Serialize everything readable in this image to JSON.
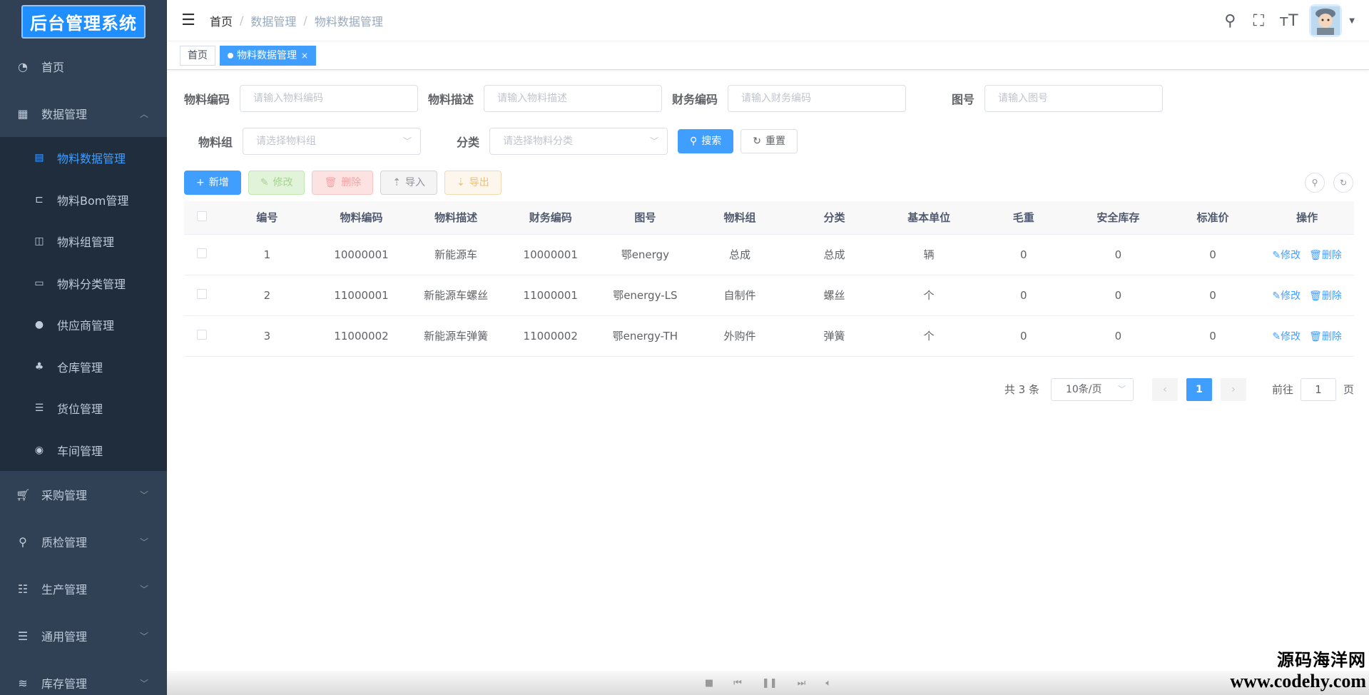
{
  "app": {
    "logo_text": "后台管理系统"
  },
  "sidebar": {
    "items": [
      {
        "label": "首页",
        "icon": "dashboard-icon"
      },
      {
        "label": "数据管理",
        "icon": "grid-icon",
        "expanded": true,
        "children": [
          {
            "label": "物料数据管理",
            "icon": "document-icon",
            "active": true
          },
          {
            "label": "物料Bom管理",
            "icon": "tree-icon"
          },
          {
            "label": "物料组管理",
            "icon": "columns-icon"
          },
          {
            "label": "物料分类管理",
            "icon": "rectangle-icon"
          },
          {
            "label": "供应商管理",
            "icon": "user-icon"
          },
          {
            "label": "仓库管理",
            "icon": "org-chart-icon"
          },
          {
            "label": "货位管理",
            "icon": "list-icon"
          },
          {
            "label": "车间管理",
            "icon": "radio-icon"
          }
        ]
      },
      {
        "label": "采购管理",
        "icon": "cart-icon"
      },
      {
        "label": "质检管理",
        "icon": "search-icon"
      },
      {
        "label": "生产管理",
        "icon": "sliders-icon"
      },
      {
        "label": "通用管理",
        "icon": "list-icon"
      },
      {
        "label": "库存管理",
        "icon": "stack-icon"
      }
    ]
  },
  "navbar": {
    "breadcrumb": [
      "首页",
      "数据管理",
      "物料数据管理"
    ]
  },
  "tags": [
    {
      "label": "首页",
      "active": false
    },
    {
      "label": "物料数据管理",
      "active": true
    }
  ],
  "filters": {
    "material_code": {
      "label": "物料编码",
      "placeholder": "请输入物料编码"
    },
    "material_desc": {
      "label": "物料描述",
      "placeholder": "请输入物料描述"
    },
    "finance_code": {
      "label": "财务编码",
      "placeholder": "请输入财务编码"
    },
    "drawing_no": {
      "label": "图号",
      "placeholder": "请输入图号"
    },
    "material_group": {
      "label": "物料组",
      "placeholder": "请选择物料组"
    },
    "category": {
      "label": "分类",
      "placeholder": "请选择物料分类"
    },
    "search_label": "搜索",
    "reset_label": "重置"
  },
  "toolbar": {
    "add_label": "新增",
    "edit_label": "修改",
    "delete_label": "删除",
    "import_label": "导入",
    "export_label": "导出"
  },
  "table": {
    "headers": [
      "编号",
      "物料编码",
      "物料描述",
      "财务编码",
      "图号",
      "物料组",
      "分类",
      "基本单位",
      "毛重",
      "安全库存",
      "标准价",
      "操作"
    ],
    "edit_action": "修改",
    "delete_action": "删除",
    "rows": [
      [
        "1",
        "10000001",
        "新能源车",
        "10000001",
        "鄂energy",
        "总成",
        "总成",
        "辆",
        "0",
        "0",
        "0"
      ],
      [
        "2",
        "11000001",
        "新能源车螺丝",
        "11000001",
        "鄂energy-LS",
        "自制件",
        "螺丝",
        "个",
        "0",
        "0",
        "0"
      ],
      [
        "3",
        "11000002",
        "新能源车弹簧",
        "11000002",
        "鄂energy-TH",
        "外购件",
        "弹簧",
        "个",
        "0",
        "0",
        "0"
      ]
    ]
  },
  "pagination": {
    "total_text": "共 3 条",
    "page_size": "10条/页",
    "current_page": "1",
    "goto_label": "前往",
    "goto_value": "1",
    "page_suffix": "页"
  },
  "watermark": {
    "line1": "源码海洋网",
    "line2": "www.codehy.com"
  }
}
